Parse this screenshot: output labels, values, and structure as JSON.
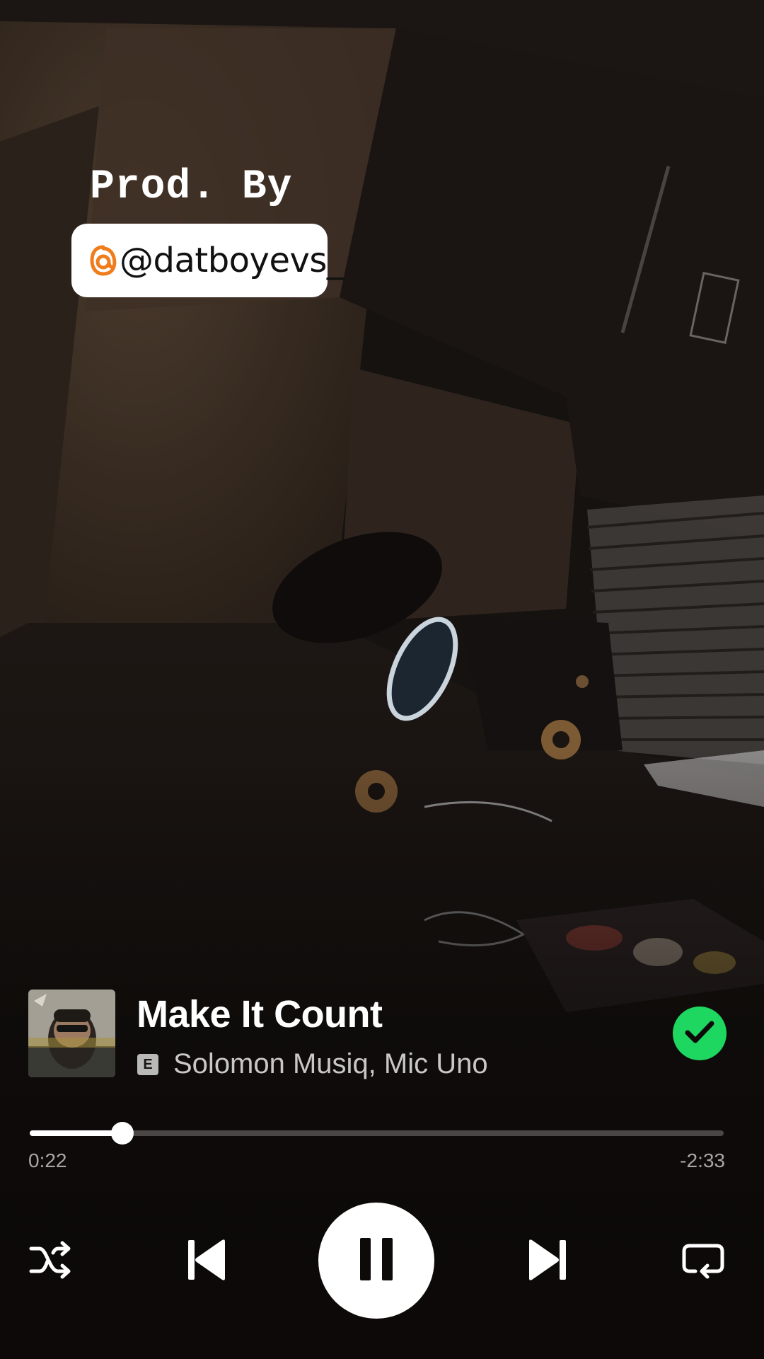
{
  "overlay": {
    "prod_label": "Prod. By",
    "mention": "@datboyevs_",
    "mention_icon": "threads-icon"
  },
  "track": {
    "title": "Make It Count",
    "explicit_badge": "E",
    "artists": "Solomon Musiq, Mic Uno",
    "liked": true
  },
  "playback": {
    "elapsed": "0:22",
    "remaining": "-2:33",
    "progress_fraction": 0.134,
    "state": "playing"
  },
  "controls": {
    "shuffle_icon": "shuffle-icon",
    "previous_icon": "skip-previous-icon",
    "play_pause_icon": "pause-icon",
    "next_icon": "skip-next-icon",
    "repeat_icon": "repeat-icon"
  },
  "colors": {
    "accent": "#1ed760",
    "mention_icon": "#f07c1c"
  }
}
